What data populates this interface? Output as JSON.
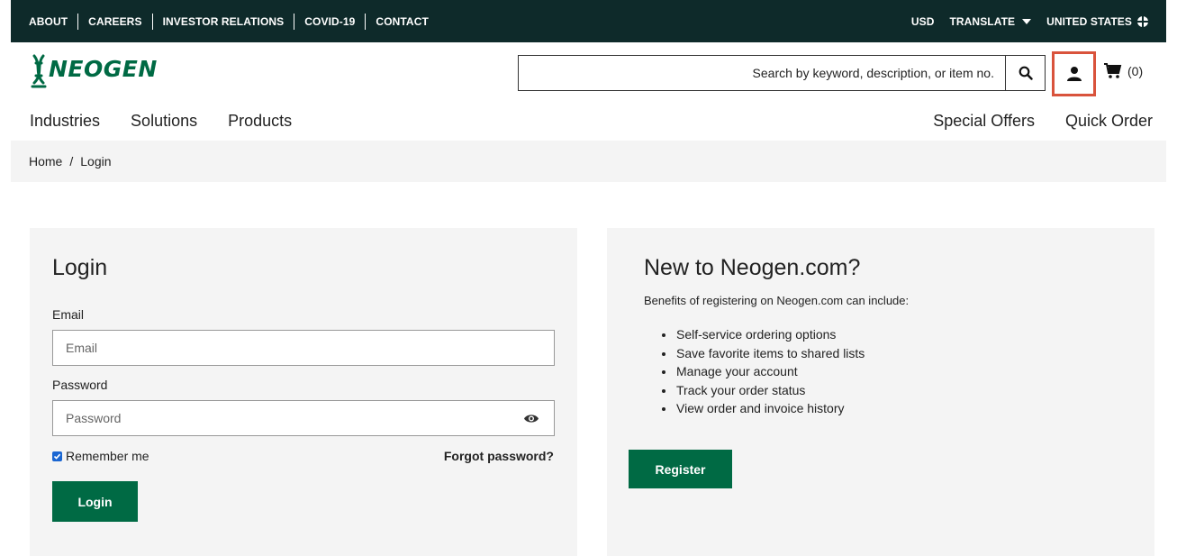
{
  "topbar": {
    "links": [
      "ABOUT",
      "CAREERS",
      "INVESTOR RELATIONS",
      "COVID-19",
      "CONTACT"
    ],
    "currency": "USD",
    "translate": "TRANSLATE",
    "region": "UNITED STATES"
  },
  "header": {
    "logo_text": "NEOGEN",
    "search_placeholder": "Search by keyword, description, or item no.",
    "cart_count": "(0)"
  },
  "nav": {
    "left": [
      "Industries",
      "Solutions",
      "Products"
    ],
    "right": [
      "Special Offers",
      "Quick Order"
    ]
  },
  "breadcrumb": {
    "home": "Home",
    "separator": "/",
    "current": "Login"
  },
  "login": {
    "title": "Login",
    "email_label": "Email",
    "email_placeholder": "Email",
    "password_label": "Password",
    "password_placeholder": "Password",
    "remember_label": "Remember me",
    "remember_checked": true,
    "forgot_label": "Forgot password?",
    "login_button": "Login"
  },
  "register": {
    "title": "New to Neogen.com?",
    "intro": "Benefits of registering on Neogen.com can include:",
    "benefits": [
      "Self-service ordering options",
      "Save favorite items to shared lists",
      "Manage your account",
      "Track your order status",
      "View order and invoice history"
    ],
    "register_button": "Register"
  },
  "colors": {
    "topbar_bg": "#0e2a2a",
    "brand_green": "#006a44",
    "highlight_border": "#d9533c",
    "panel_bg": "#f4f4f4"
  }
}
